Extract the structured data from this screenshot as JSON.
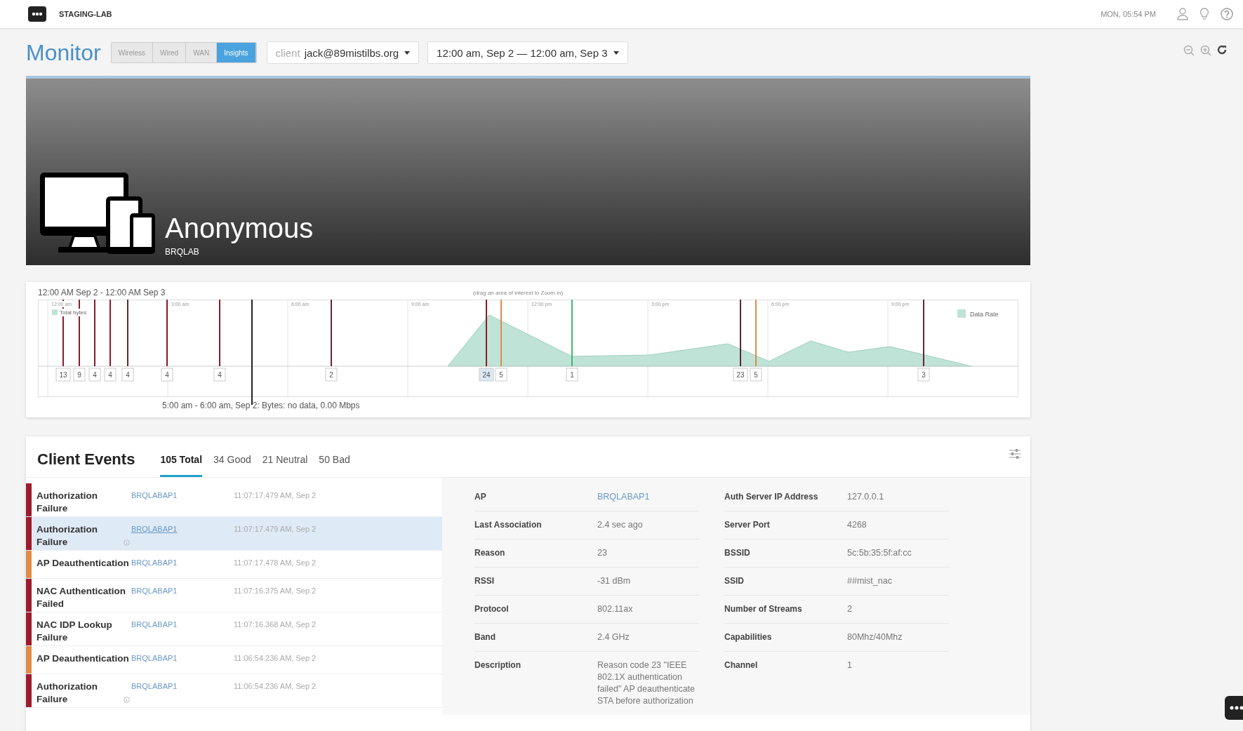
{
  "topbar": {
    "org": "STAGING-LAB",
    "clock": "MON, 05:54 PM"
  },
  "monitor": {
    "title": "Monitor",
    "tabs": [
      {
        "label": "Wireless",
        "selected": false
      },
      {
        "label": "Wired",
        "selected": false
      },
      {
        "label": "WAN",
        "selected": false
      },
      {
        "label": "Insights",
        "selected": true
      }
    ],
    "client_filter": {
      "prefix": "client",
      "value": "jack@89mistilbs.org"
    },
    "range": "12:00 am, Sep 2 — 12:00 am, Sep 3"
  },
  "banner": {
    "name": "Anonymous",
    "site": "BRQLAB"
  },
  "timeline": {
    "range_label": "12:00 AM Sep 2 - 12:00 AM Sep 3",
    "hint": "(drag an area of interest to Zoom in)",
    "legend_left": "Total bytes",
    "legend_right": "Data Rate",
    "ticks": [
      "12:00 am",
      "3:00 am",
      "6:00 am",
      "9:00 am",
      "12:00 pm",
      "3:00 pm",
      "6:00 pm",
      "9:00 pm"
    ],
    "markers": [
      {
        "count": "13",
        "color": "#8b1c2a",
        "selected": false
      },
      {
        "count": "9",
        "color": "#8b1c2a",
        "selected": false
      },
      {
        "count": "4",
        "color": "#8b1c2a",
        "selected": false
      },
      {
        "count": "4",
        "color": "#8b1c2a",
        "selected": false
      },
      {
        "count": "4",
        "color": "#5a2a2a",
        "selected": false
      },
      {
        "count": "4",
        "color": "#8b1c2a",
        "selected": false
      },
      {
        "count": "4",
        "color": "#8b1c2a",
        "selected": false
      },
      {
        "count": "2",
        "color": "#6b2430",
        "selected": false
      },
      {
        "count": "24",
        "color": "#8b1c2a",
        "selected": true
      },
      {
        "count": "5",
        "color": "#e08a4a",
        "selected": false
      },
      {
        "count": "1",
        "color": "#3cb878",
        "selected": false
      },
      {
        "count": "23",
        "color": "#5a2a2a",
        "selected": false
      },
      {
        "count": "5",
        "color": "#e08a4a",
        "selected": false
      },
      {
        "count": "3",
        "color": "#6b2430",
        "selected": false
      }
    ],
    "hover_label": "5:00 am - 6:00 am, Sep 2: Bytes: no data, 0.00 Mbps"
  },
  "events": {
    "title": "Client Events",
    "tabs": [
      {
        "label": "105 Total",
        "selected": true
      },
      {
        "label": "34 Good",
        "selected": false
      },
      {
        "label": "21 Neutral",
        "selected": false
      },
      {
        "label": "50 Bad",
        "selected": false
      }
    ],
    "rows": [
      {
        "name": "Authorization Failure",
        "ap": "BRQLABAP1",
        "time": "11:07:17.479 AM, Sep 2",
        "color": "#9b1c2c",
        "info": false,
        "selected": false
      },
      {
        "name": "Authorization Failure",
        "ap": "BRQLABAP1",
        "time": "11:07:17.479 AM, Sep 2",
        "color": "#9b1c2c",
        "info": true,
        "selected": true
      },
      {
        "name": "AP Deauthentication",
        "ap": "BRQLABAP1",
        "time": "11:07:17.478 AM, Sep 2",
        "color": "#e08a4a",
        "info": false,
        "selected": false
      },
      {
        "name": "NAC Authentication Failed",
        "ap": "BRQLABAP1",
        "time": "11:07:16.375 AM, Sep 2",
        "color": "#9b1c2c",
        "info": false,
        "selected": false
      },
      {
        "name": "NAC IDP Lookup Failure",
        "ap": "BRQLABAP1",
        "time": "11:07:16.368 AM, Sep 2",
        "color": "#9b1c2c",
        "info": false,
        "selected": false
      },
      {
        "name": "AP Deauthentication",
        "ap": "BRQLABAP1",
        "time": "11:06:54.236 AM, Sep 2",
        "color": "#e08a4a",
        "info": false,
        "selected": false
      },
      {
        "name": "Authorization Failure",
        "ap": "BRQLABAP1",
        "time": "11:06:54.236 AM, Sep 2",
        "color": "#9b1c2c",
        "info": true,
        "selected": false
      }
    ],
    "details": {
      "left": [
        {
          "label": "AP",
          "value": "BRQLABAP1",
          "kind": "link"
        },
        {
          "label": "Last Association",
          "value": "2.4 sec ago",
          "kind": "text"
        },
        {
          "label": "Reason",
          "value": "23",
          "kind": "text"
        },
        {
          "label": "RSSI",
          "value": "-31 dBm",
          "kind": "text"
        },
        {
          "label": "Protocol",
          "value": "802.11ax",
          "kind": "text"
        },
        {
          "label": "Band",
          "value": "2.4 GHz",
          "kind": "text"
        },
        {
          "label": "Description",
          "value": "Reason code 23 \"IEEE 802.1X authentication failed\" AP deauthenticate STA before authorization",
          "kind": "text"
        }
      ],
      "right": [
        {
          "label": "Auth Server IP Address",
          "value": "127.0.0.1",
          "kind": "text"
        },
        {
          "label": "Server Port",
          "value": "4268",
          "kind": "text"
        },
        {
          "label": "BSSID",
          "value": "5c:5b:35:5f:af:cc",
          "kind": "text"
        },
        {
          "label": "SSID",
          "value": "##mist_nac",
          "kind": "text"
        },
        {
          "label": "Number of Streams",
          "value": "2",
          "kind": "text"
        },
        {
          "label": "Capabilities",
          "value": "80Mhz/40Mhz",
          "kind": "text"
        },
        {
          "label": "Channel",
          "value": "1",
          "kind": "text"
        }
      ]
    }
  }
}
